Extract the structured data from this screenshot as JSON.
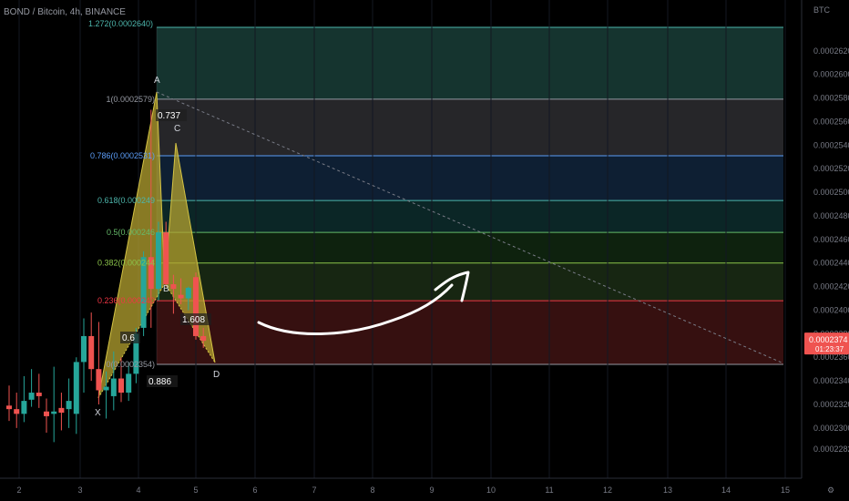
{
  "header": {
    "title": "BOND / Bitcoin, 4h, BINANCE"
  },
  "price_axis": {
    "unit": "BTC"
  },
  "time_axis": {
    "labels": [
      "2",
      "3",
      "4",
      "5",
      "6",
      "7",
      "8",
      "9",
      "10",
      "11",
      "12",
      "13",
      "14",
      "15"
    ]
  },
  "colors": {
    "up": "#26a69a",
    "down": "#ef5350",
    "pattern": "#b5a330",
    "background": "#000000"
  },
  "chart_data": {
    "type": "candlestick",
    "symbol": "BOND / Bitcoin",
    "interval": "4h",
    "exchange": "BINANCE",
    "yunit": "BTC",
    "ylim": [
      0.000227,
      0.000265
    ],
    "y_ticks": [
      0.0002282,
      0.00023,
      0.000232,
      0.000234,
      0.000236,
      0.000238,
      0.00024,
      0.000242,
      0.000244,
      0.000246,
      0.000248,
      0.00025,
      0.000252,
      0.000254,
      0.000256,
      0.000258,
      0.00026,
      0.000262
    ],
    "last_price": {
      "value": "0.0002374",
      "countdown": "01:23:37"
    },
    "candles": [
      {
        "o": 0.0002319,
        "h": 0.0002336,
        "l": 0.0002306,
        "c": 0.0002316
      },
      {
        "o": 0.0002316,
        "h": 0.000233,
        "l": 0.00023,
        "c": 0.0002312
      },
      {
        "o": 0.0002312,
        "h": 0.0002344,
        "l": 0.0002305,
        "c": 0.0002323
      },
      {
        "o": 0.0002324,
        "h": 0.000235,
        "l": 0.0002318,
        "c": 0.000233
      },
      {
        "o": 0.000233,
        "h": 0.0002346,
        "l": 0.0002317,
        "c": 0.0002327
      },
      {
        "o": 0.0002314,
        "h": 0.0002325,
        "l": 0.0002296,
        "c": 0.000231
      },
      {
        "o": 0.0002312,
        "h": 0.0002352,
        "l": 0.0002288,
        "c": 0.0002314
      },
      {
        "o": 0.0002317,
        "h": 0.000233,
        "l": 0.0002298,
        "c": 0.0002313
      },
      {
        "o": 0.0002316,
        "h": 0.0002342,
        "l": 0.00023,
        "c": 0.0002323
      },
      {
        "o": 0.0002312,
        "h": 0.000236,
        "l": 0.0002295,
        "c": 0.0002356
      },
      {
        "o": 0.0002356,
        "h": 0.0002393,
        "l": 0.000233,
        "c": 0.0002378
      },
      {
        "o": 0.0002378,
        "h": 0.0002398,
        "l": 0.000234,
        "c": 0.000235
      },
      {
        "o": 0.000235,
        "h": 0.000239,
        "l": 0.000232,
        "c": 0.0002332
      },
      {
        "o": 0.0002332,
        "h": 0.0002348,
        "l": 0.0002308,
        "c": 0.0002335
      },
      {
        "o": 0.0002327,
        "h": 0.0002365,
        "l": 0.0002315,
        "c": 0.0002342
      },
      {
        "o": 0.0002342,
        "h": 0.000236,
        "l": 0.0002322,
        "c": 0.000233
      },
      {
        "o": 0.000233,
        "h": 0.0002356,
        "l": 0.0002323,
        "c": 0.0002346
      },
      {
        "o": 0.0002346,
        "h": 0.0002385,
        "l": 0.0002338,
        "c": 0.000238
      },
      {
        "o": 0.0002385,
        "h": 0.000245,
        "l": 0.0002378,
        "c": 0.0002445
      },
      {
        "o": 0.0002445,
        "h": 0.000257,
        "l": 0.0002385,
        "c": 0.0002418
      },
      {
        "o": 0.0002418,
        "h": 0.0002475,
        "l": 0.0002408,
        "c": 0.0002466
      },
      {
        "o": 0.0002466,
        "h": 0.0002475,
        "l": 0.000242,
        "c": 0.0002422
      },
      {
        "o": 0.0002422,
        "h": 0.000243,
        "l": 0.0002397,
        "c": 0.0002418
      },
      {
        "o": 0.0002413,
        "h": 0.0002427,
        "l": 0.0002405,
        "c": 0.000241
      },
      {
        "o": 0.000241,
        "h": 0.000242,
        "l": 0.00024,
        "c": 0.0002419
      },
      {
        "o": 0.0002428,
        "h": 0.0002432,
        "l": 0.0002375,
        "c": 0.0002378
      },
      {
        "o": 0.0002378,
        "h": 0.0002385,
        "l": 0.0002368,
        "c": 0.0002374
      }
    ],
    "fib_retracement": {
      "levels": [
        {
          "ratio": "1",
          "price": "0.0002579",
          "label": "1(0.0002579)",
          "color": "#9598a1",
          "fill": "#2a2a2d"
        },
        {
          "ratio": "0.786",
          "price": "0.0002531",
          "label": "0.786(0.0002531)",
          "color": "#5b9cf6",
          "fill": "#102238"
        },
        {
          "ratio": "0.618",
          "price": "0.0002493",
          "label": "0.618(0.000249",
          "color": "#4db6ac",
          "fill": "#0c2a2a"
        },
        {
          "ratio": "0.5",
          "price": "0.0002466",
          "label": "0.5(0.000246",
          "color": "#66bb6a",
          "fill": "#10260f"
        },
        {
          "ratio": "0.382",
          "price": "0.0002440",
          "label": "0.382(0.000244",
          "color": "#8bc34a",
          "fill": "#1a2a14"
        },
        {
          "ratio": "0.236",
          "price": "0.0002408",
          "label": "0.236(0.000240",
          "color": "#f23645",
          "fill": "#3c1212"
        },
        {
          "ratio": "0",
          "price": "0.0002354",
          "label": "0(0.0002354)",
          "color": "#9598a1"
        },
        {
          "ratio": "1.272",
          "price": "0.0002640",
          "label": "1.272(0.0002640)",
          "color": "#4db6ac",
          "fill": "#173a34"
        }
      ]
    },
    "harmonic_pattern": {
      "points": [
        {
          "name": "X",
          "price": 0.0002323
        },
        {
          "name": "A",
          "price": 0.0002579
        },
        {
          "name": "B",
          "price": 0.000241
        },
        {
          "name": "C",
          "price": 0.0002535
        },
        {
          "name": "D",
          "price": 0.0002354
        }
      ],
      "ratios": [
        "0.737",
        "0.6",
        "1.608",
        "0.886"
      ]
    }
  }
}
